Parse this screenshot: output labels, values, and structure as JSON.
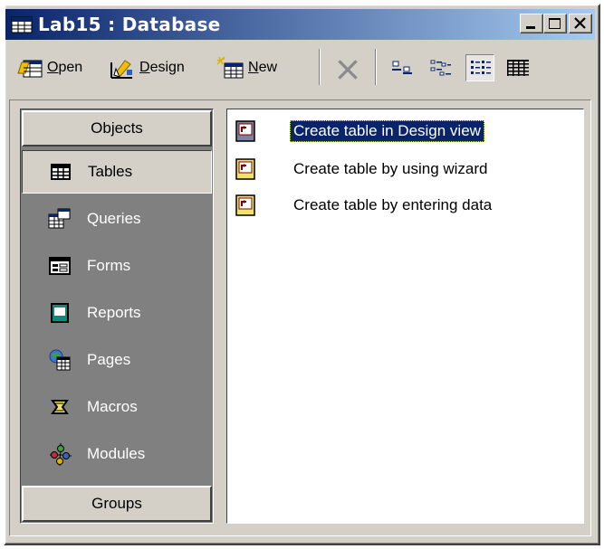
{
  "window": {
    "title": "Lab15 : Database",
    "controls": [
      "minimize",
      "maximize",
      "close"
    ]
  },
  "toolbar": {
    "open_label_u": "O",
    "open_label_rest": "pen",
    "design_label_u": "D",
    "design_label_rest": "esign",
    "new_label_u": "N",
    "new_label_rest": "ew",
    "view_icons": [
      "large-icons-icon",
      "small-icons-icon",
      "list-icon",
      "details-icon"
    ]
  },
  "objects_bar": {
    "header": "Objects",
    "footer": "Groups",
    "items": [
      {
        "label": "Tables",
        "icon": "tables-icon",
        "selected": true
      },
      {
        "label": "Queries",
        "icon": "queries-icon"
      },
      {
        "label": "Forms",
        "icon": "forms-icon"
      },
      {
        "label": "Reports",
        "icon": "reports-icon"
      },
      {
        "label": "Pages",
        "icon": "pages-icon"
      },
      {
        "label": "Macros",
        "icon": "macros-icon"
      },
      {
        "label": "Modules",
        "icon": "modules-icon"
      }
    ]
  },
  "list": {
    "items": [
      {
        "label": "Create table in Design view",
        "selected": true
      },
      {
        "label": "Create table by using wizard"
      },
      {
        "label": "Create table by entering data"
      }
    ]
  },
  "colors": {
    "titlebar_start": "#0a246a",
    "titlebar_end": "#a6caf0",
    "face": "#d4d0c8",
    "objbar_bg": "#808080",
    "selection": "#0a246a"
  }
}
